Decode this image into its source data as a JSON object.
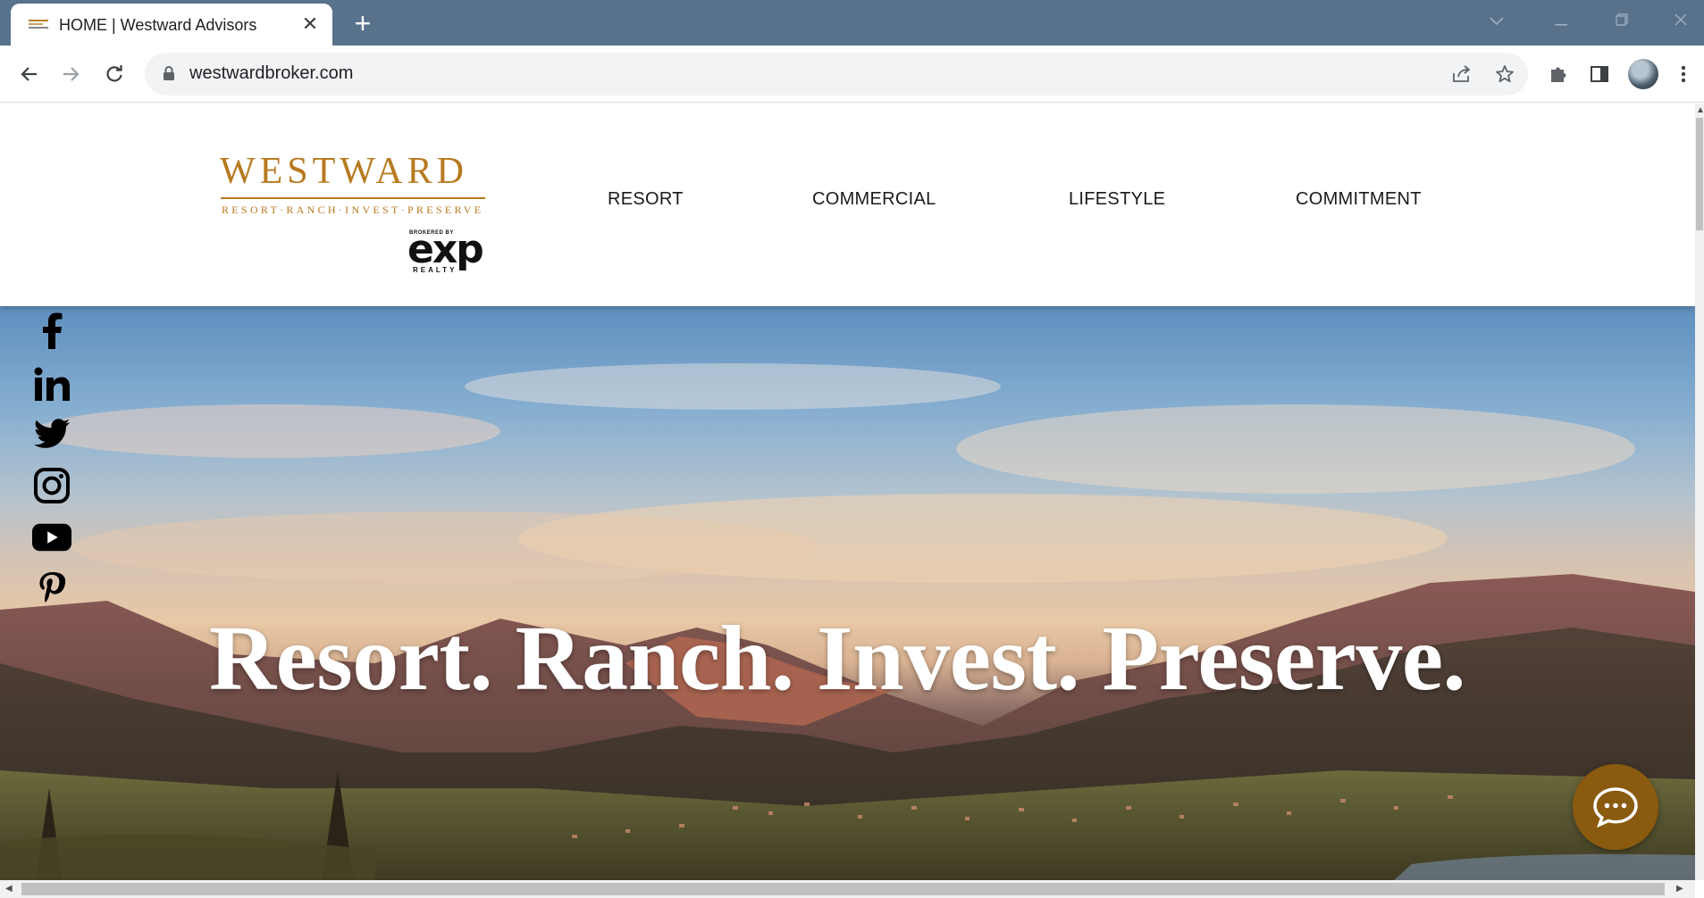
{
  "browser": {
    "tab_title": "HOME | Westward Advisors",
    "url": "westwardbroker.com",
    "new_tab_symbol": "+",
    "close_symbol": "✕"
  },
  "site": {
    "logo": {
      "wordmark": "WESTWARD",
      "tagline": "RESORT·RANCH·INVEST·PRESERVE",
      "brokered_by": "BROKERED BY",
      "exp": "exp",
      "realty": "REALTY"
    },
    "nav": [
      "RESORT",
      "COMMERCIAL",
      "LIFESTYLE",
      "COMMITMENT"
    ],
    "hero_title": "Resort. Ranch. Invest. Preserve.",
    "social": [
      "facebook-icon",
      "linkedin-icon",
      "twitter-icon",
      "instagram-icon",
      "youtube-icon",
      "pinterest-icon"
    ]
  },
  "colors": {
    "brand_gold": "#b8791f",
    "chat_button": "#8a5a0f",
    "tabbar": "#58728c"
  }
}
